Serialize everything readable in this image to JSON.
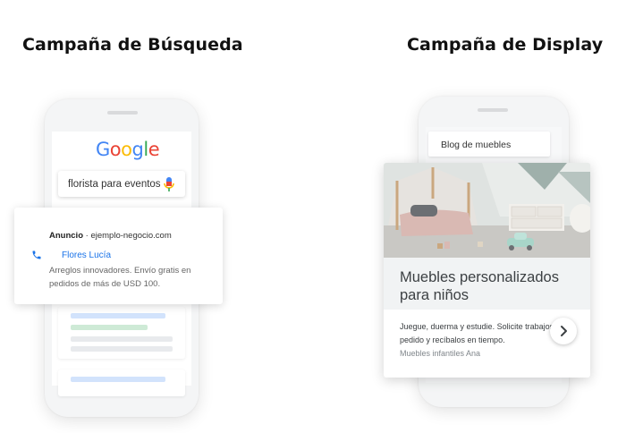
{
  "titles": {
    "search": "Campaña de Búsqueda",
    "display": "Campaña de Display"
  },
  "search_phone": {
    "logo_letters": [
      "G",
      "o",
      "o",
      "g",
      "l",
      "e"
    ],
    "logo_colors": [
      "#4285F4",
      "#EA4335",
      "#FBBC05",
      "#4285F4",
      "#34A853",
      "#EA4335"
    ],
    "query": "florista para eventos",
    "mic_icon": "mic-icon",
    "ad": {
      "label": "Anuncio",
      "separator": " · ",
      "domain": "ejemplo-negocio.com",
      "icon": "phone-icon",
      "name": "Flores Lucía",
      "description": "Arreglos innovadores. Envío gratis en pedidos de más de USD 100."
    }
  },
  "display_phone": {
    "url": "Blog de muebles",
    "headline": "Muebles personalizados para niños",
    "body": "Juegue, duerma y estudie. Solicite trabajos a pedido y recíbalos en tiempo.",
    "brand": "Muebles infantiles Ana",
    "arrow_icon": "chevron-right-icon"
  },
  "colors": {
    "link_blue": "#1a73e8",
    "skeleton_blue": "#d2e3fc",
    "skeleton_green": "#ceead6",
    "skeleton_gray": "#e8eaed"
  }
}
